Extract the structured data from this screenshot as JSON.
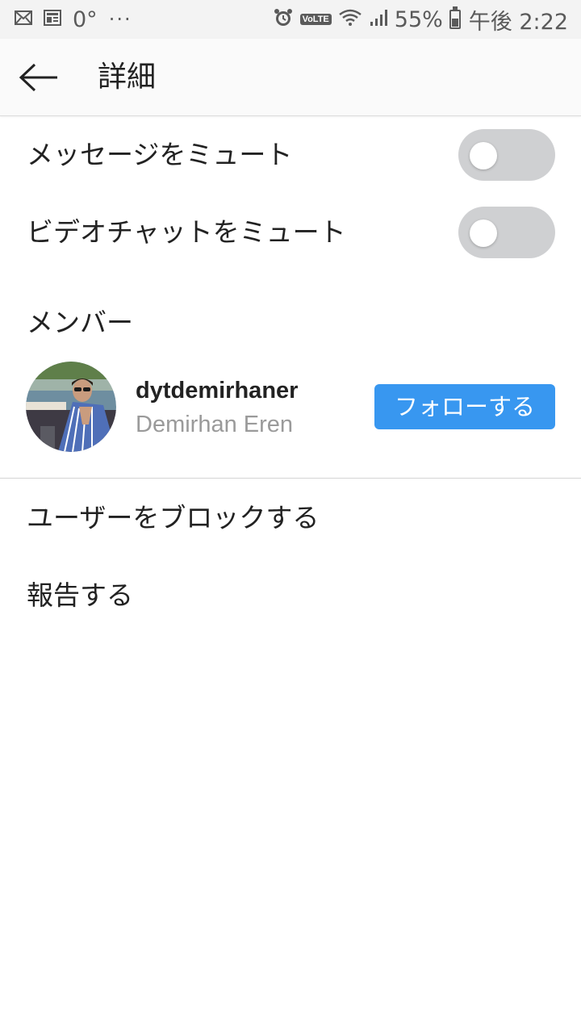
{
  "status_bar": {
    "temperature": "0°",
    "more": "···",
    "volte": "VoLTE",
    "battery": "55%",
    "time": "午後 2:22",
    "left_icons": [
      "mail-icon",
      "news-icon"
    ],
    "right_icons": [
      "alarm-icon",
      "volte-icon",
      "wifi-icon",
      "signal-icon",
      "battery-icon"
    ]
  },
  "header": {
    "title": "詳細",
    "back_icon": "arrow-left-icon"
  },
  "settings": {
    "mute_messages": {
      "label": "メッセージをミュート",
      "on": false
    },
    "mute_video_chat": {
      "label": "ビデオチャットをミュート",
      "on": false
    }
  },
  "members": {
    "title": "メンバー",
    "items": [
      {
        "username": "dytdemirhaner",
        "full_name": "Demirhan Eren",
        "follow_label": "フォローする"
      }
    ]
  },
  "actions": {
    "block": "ユーザーをブロックする",
    "report": "報告する"
  },
  "colors": {
    "accent": "#3897f0",
    "toggle_off": "#cfd0d2",
    "secondary_text": "#9a9a9a"
  }
}
